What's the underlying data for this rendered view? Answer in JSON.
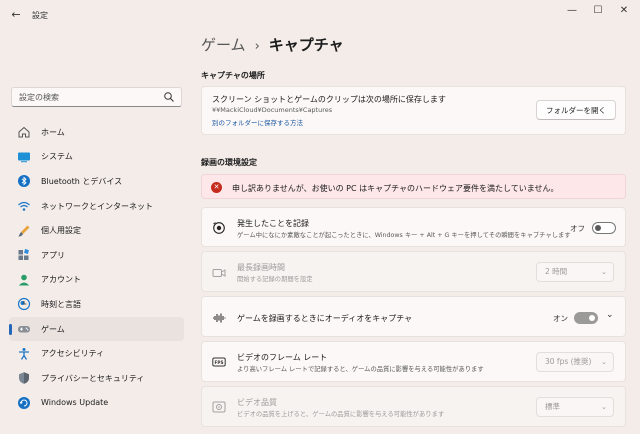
{
  "window": {
    "title": "設定",
    "back": "←",
    "minimize": "—",
    "maximize": "☐",
    "close": "✕"
  },
  "search": {
    "placeholder": "設定の検索"
  },
  "sidebar": {
    "items": [
      {
        "label": "ホーム",
        "icon": "home-icon",
        "active": false
      },
      {
        "label": "システム",
        "icon": "system-icon",
        "active": false
      },
      {
        "label": "Bluetooth とデバイス",
        "icon": "bluetooth-icon",
        "active": false
      },
      {
        "label": "ネットワークとインターネット",
        "icon": "network-icon",
        "active": false
      },
      {
        "label": "個人用設定",
        "icon": "personalization-icon",
        "active": false
      },
      {
        "label": "アプリ",
        "icon": "apps-icon",
        "active": false
      },
      {
        "label": "アカウント",
        "icon": "account-icon",
        "active": false
      },
      {
        "label": "時刻と言語",
        "icon": "time-language-icon",
        "active": false
      },
      {
        "label": "ゲーム",
        "icon": "gaming-icon",
        "active": true
      },
      {
        "label": "アクセシビリティ",
        "icon": "accessibility-icon",
        "active": false
      },
      {
        "label": "プライバシーとセキュリティ",
        "icon": "privacy-icon",
        "active": false
      },
      {
        "label": "Windows Update",
        "icon": "windows-update-icon",
        "active": false
      }
    ]
  },
  "header": {
    "parent": "ゲーム",
    "separator": "›",
    "current": "キャプチャ"
  },
  "capture_location": {
    "section": "キャプチャの場所",
    "title": "スクリーン ショットとゲームのクリップは次の場所に保存します",
    "path": "¥¥MackiCloud¥Documents¥Captures",
    "link": "別のフォルダーに保存する方法",
    "button": "フォルダーを開く"
  },
  "recording": {
    "section": "録画の環境設定",
    "error": "申し訳ありませんが、お使いの PC はキャプチャのハードウェア要件を満たしていません。",
    "record_what_happened": {
      "title": "発生したことを記録",
      "desc": "ゲーム中になにか素敵なことが起こったときに、Windows キー + Alt + G キーを押してその瞬間をキャプチャします",
      "state": "オフ"
    },
    "max_length": {
      "title": "最長録画時間",
      "desc": "開始する記録の期間を設定",
      "value": "2 時間"
    },
    "capture_audio": {
      "title": "ゲームを録画するときにオーディオをキャプチャ",
      "state": "オン"
    },
    "frame_rate": {
      "title": "ビデオのフレーム レート",
      "desc": "より高いフレーム レートで記録すると、ゲームの品質に影響を与える可能性があります",
      "value": "30 fps (推奨)"
    },
    "video_quality": {
      "title": "ビデオ品質",
      "desc": "ビデオの品質を上げると、ゲームの品質に影響を与える可能性があります",
      "value": "標準"
    }
  },
  "colors": {
    "accent": "#2467b8",
    "error": "#c42b1c",
    "error_bg": "#fde7e9"
  }
}
